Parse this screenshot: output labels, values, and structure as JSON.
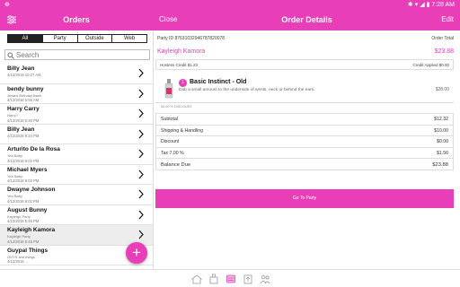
{
  "status_bar": {
    "left": "⊕",
    "right": "✱ ▾ ◢ ▮ 7:28 AM"
  },
  "header": {
    "title": "Orders",
    "close_label": "Close",
    "detail_title": "Order Details",
    "edit_label": "Edit"
  },
  "filters": [
    "All",
    "Party",
    "Outside",
    "Web"
  ],
  "active_filter": "All",
  "search": {
    "placeholder": "Search"
  },
  "orders": [
    {
      "name": "Billy Jean",
      "sub": "",
      "date": "4/12/2018 10:27 AM"
    },
    {
      "name": "bendy bunny",
      "sub": "Jewels Birthday Bash",
      "date": "4/12/2018 5:55 AM"
    },
    {
      "name": "Harry Carry",
      "sub": "Harry?",
      "date": "4/12/2018 6:30 PM"
    },
    {
      "name": "Billy Jean",
      "sub": "",
      "date": "4/12/2018 9:24 PM"
    },
    {
      "name": "Arturito De la Rosa",
      "sub": "Yea Baby",
      "date": "4/12/2018 6:02 PM"
    },
    {
      "name": "Michael Myers",
      "sub": "Yea Baby",
      "date": "4/12/2018 6:02 PM"
    },
    {
      "name": "Dwayne Johnson",
      "sub": "Yea Baby",
      "date": "4/12/2018 6:02 PM"
    },
    {
      "name": "August Bunny",
      "sub": "Kayleigh Party",
      "date": "4/12/2018 5:45 PM"
    },
    {
      "name": "Kayleigh Kamora",
      "sub": "Kayleigh Party",
      "date": "4/12/2018 5:45 PM"
    },
    {
      "name": "Guypal Things",
      "sub": "GUYS and things",
      "date": "4/12/2018 ..."
    }
  ],
  "selected_order_index": 8,
  "detail": {
    "party_id": "Party ID 87631032946787820078",
    "order_total_label": "Order Total",
    "customer_name": "Kayleigh Kamora",
    "order_total": "$23.88",
    "hostess_credit": "Hostess Credit  $1.23",
    "credit_applied": "Credit Applied $0.00",
    "item": {
      "qty": "1",
      "name": "Basic Instinct - Old",
      "description": "Dab a small amount to the underside of wrists, neck or behind the ears.",
      "price": "$28.00"
    },
    "discount_note": "50.00 % DISCOUNT",
    "summary": [
      {
        "label": "Subtotal",
        "value": "$12.32"
      },
      {
        "label": "Shipping & Handling",
        "value": "$10.00"
      },
      {
        "label": "Discount",
        "value": "$0.00"
      },
      {
        "label": "Tax   7.00 %",
        "value": "$1.56"
      }
    ],
    "balance_label": "Balance Due",
    "balance_value": "$23.88",
    "go_to_party_label": "Go To Party"
  },
  "bottom_nav": [
    "home-icon",
    "store-icon",
    "orders-icon",
    "upload-icon",
    "people-icon"
  ],
  "colors": {
    "accent": "#e83eb8",
    "dark": "#222222"
  }
}
